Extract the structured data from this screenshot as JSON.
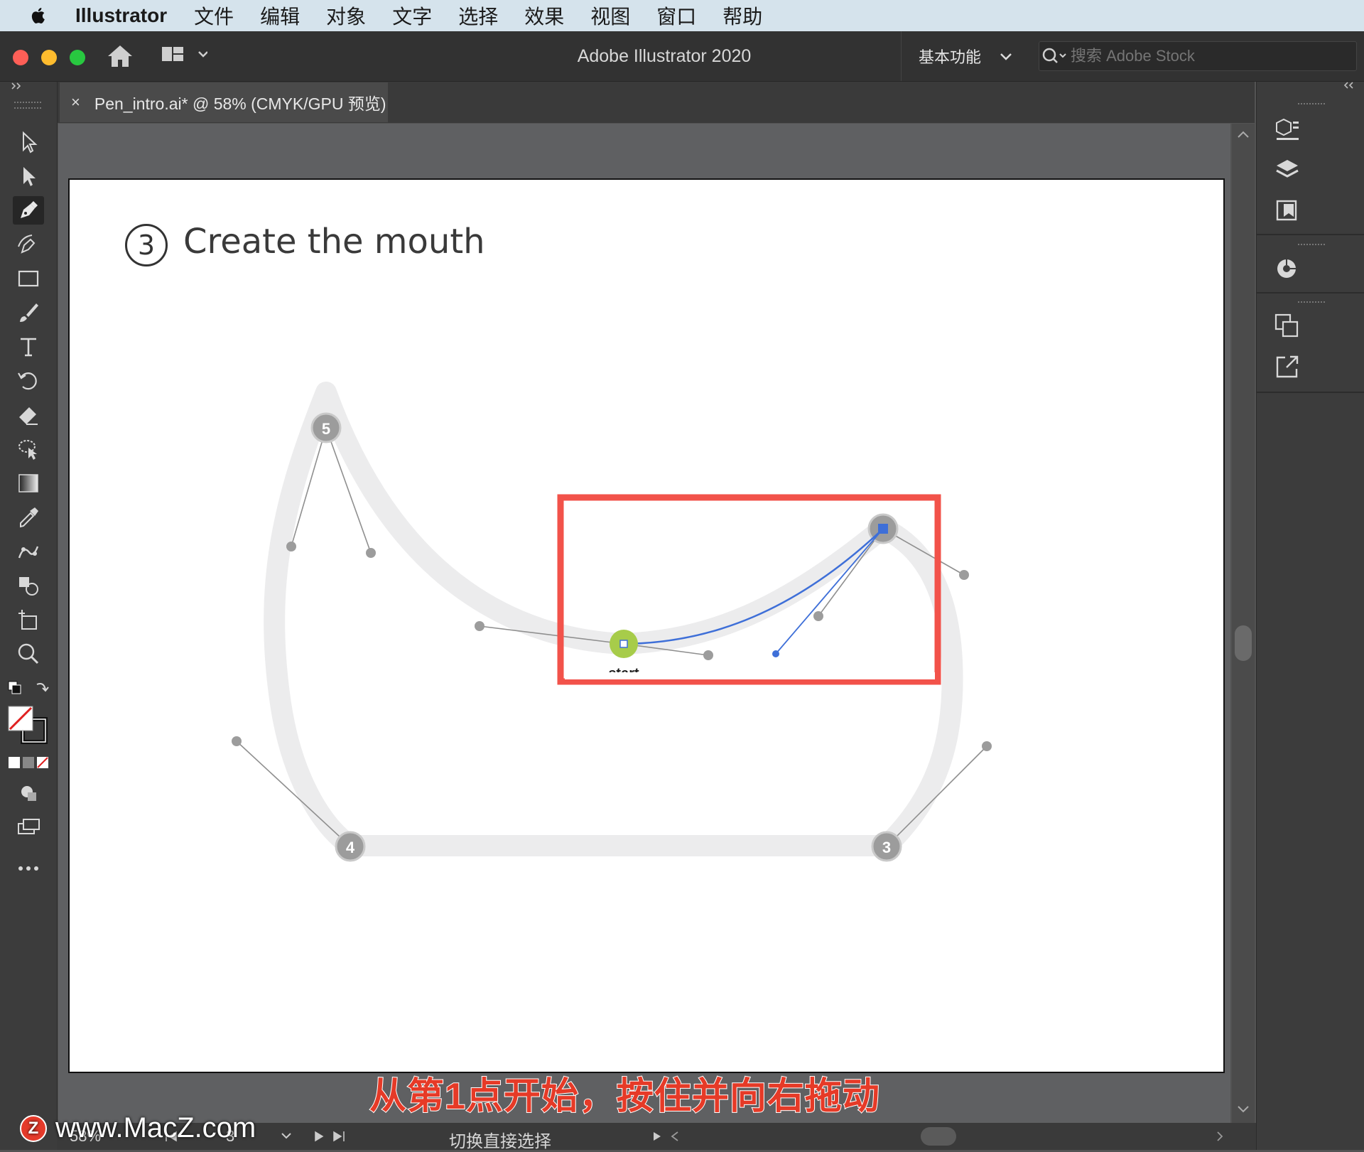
{
  "menubar": {
    "app": "Illustrator",
    "items": [
      "文件",
      "编辑",
      "对象",
      "文字",
      "选择",
      "效果",
      "视图",
      "窗口",
      "帮助"
    ]
  },
  "titlebar": {
    "title": "Adobe Illustrator 2020",
    "workspace": "基本功能",
    "search_placeholder": "搜索 Adobe Stock"
  },
  "tab": {
    "close": "×",
    "label": "Pen_intro.ai* @ 58% (CMYK/GPU 预览)"
  },
  "artboard": {
    "step_number": "3",
    "step_title": "Create the mouth",
    "anchor_labels": [
      "5",
      "4",
      "3"
    ],
    "start_label": "start"
  },
  "statusbar": {
    "zoom": "58%",
    "page": "3",
    "tool_hint": "切换直接选择"
  },
  "overlay": {
    "caption": "从第1点开始，按住并向右拖动",
    "watermark": "www.MacZ.com",
    "watermark_badge": "Z"
  },
  "colors": {
    "highlight_box": "#f2524a",
    "start_anchor": "#a7cc4a",
    "path_blue": "#3e6fd8",
    "guide_path": "#ececed"
  }
}
